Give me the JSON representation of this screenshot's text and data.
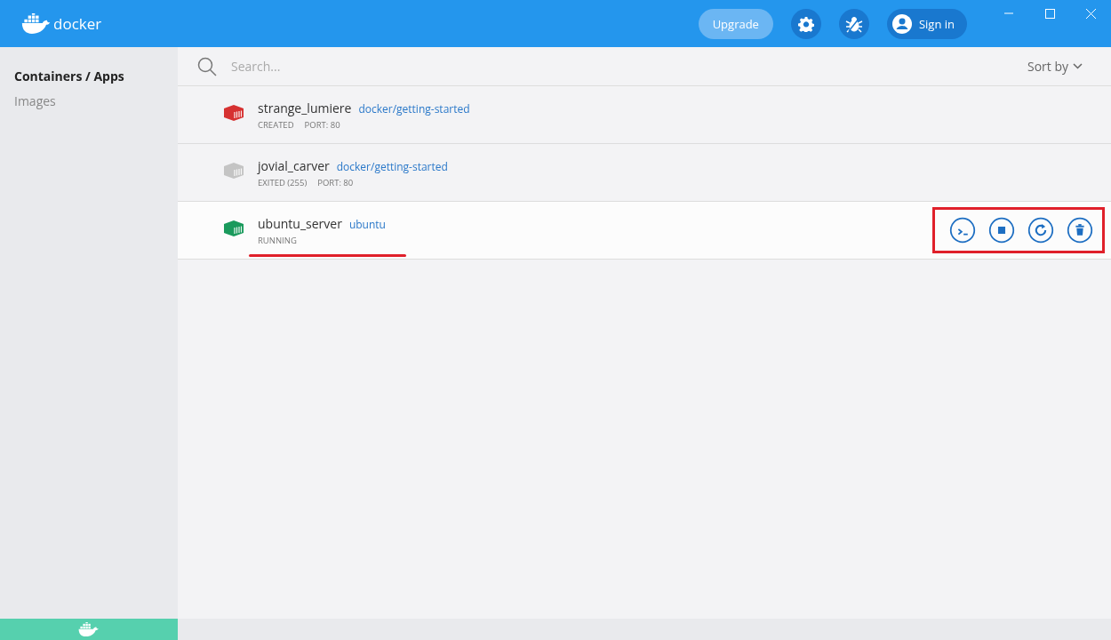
{
  "header": {
    "logo": "docker",
    "upgrade": "Upgrade",
    "sign_in": "Sign in"
  },
  "sidebar": {
    "items": [
      {
        "label": "Containers / Apps",
        "selected": true
      },
      {
        "label": "Images",
        "selected": false
      }
    ]
  },
  "search": {
    "placeholder": "Search..."
  },
  "sort": {
    "label": "Sort by"
  },
  "containers": [
    {
      "name": "strange_lumiere",
      "image": "docker/getting-started",
      "status": "CREATED",
      "port": "PORT: 80",
      "color": "#d63131"
    },
    {
      "name": "jovial_carver",
      "image": "docker/getting-started",
      "status": "EXITED (255)",
      "port": "PORT: 80",
      "color": "#c4c4c4"
    },
    {
      "name": "ubuntu_server",
      "image": "ubuntu",
      "status": "RUNNING",
      "color": "#1a9a5c",
      "hovered": true,
      "underlined": true,
      "actions_highlighted": true
    }
  ]
}
